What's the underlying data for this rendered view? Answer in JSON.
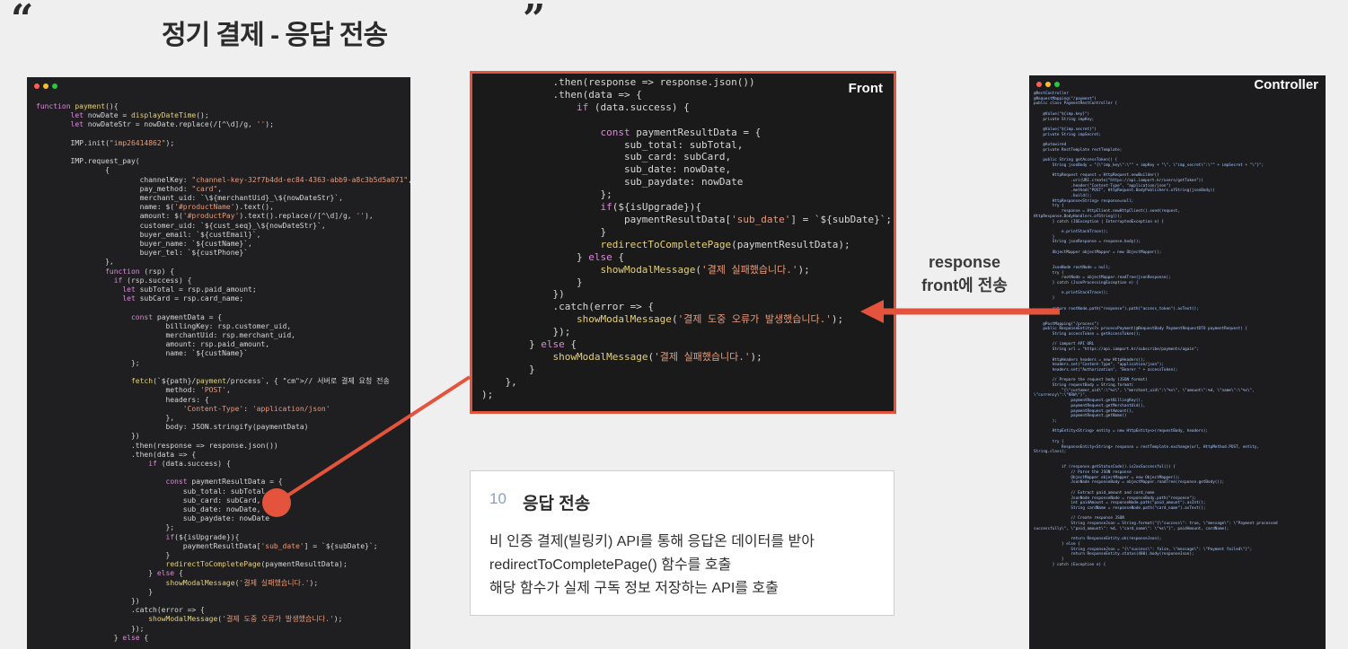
{
  "slide": {
    "open_quote": "“",
    "close_quote": "”",
    "title": "정기 결제 - 응답 전송"
  },
  "left_code": {
    "text": "function payment(){\n\tlet nowDate = displayDateTime();\n\tlet nowDateStr = nowDate.replace(/[^\\d]/g, '');\n\n\tIMP.init(\"imp26414862\");\n\n\tIMP.request_pay(\n\t\t{\n\t\t\tchannelKey: \"channel-key-32f7b4dd-ec84-4363-abb9-a8c3b5d5a071\",\n\t\t\tpay_method: \"card\",\n\t\t\tmerchant_uid: `\\${merchantUid}_\\${nowDateStr}`,\n\t\t\tname: $('#productName').text(),\n\t\t\tamount: $('#productPay').text().replace(/[^\\d]/g, ''),\n\t\t\tcustomer_uid: `${cust_seq}_\\${nowDateStr}`,\n\t\t\tbuyer_email: `${custEmail}`,\n\t\t\tbuyer_name: `${custName}`,\n\t\t\tbuyer_tel: `${custPhone}`\n\t\t},\n\t\tfunction (rsp) {\n\t\t  if (rsp.success) {\n\t\t    let subTotal = rsp.paid_amount;\n\t\t    let subCard = rsp.card_name;\n\n\t\t      const paymentData = {\n\t\t\t      billingKey: rsp.customer_uid,\n\t\t\t      merchantUid: rsp.merchant_uid,\n\t\t\t      amount: rsp.paid_amount,\n\t\t\t      name: `${custName}`\n\t\t      };\n\n\t\t      fetch(`${path}/payment/process`, { // 서버로 결제 요청 전송\n\t\t\t      method: 'POST',\n\t\t\t      headers: {\n\t\t\t\t  'Content-Type': 'application/json'\n\t\t\t      },\n\t\t\t      body: JSON.stringify(paymentData)\n\t\t      })\n\t\t      .then(response => response.json())\n\t\t      .then(data => {\n\t\t\t  if (data.success) {\n\n\t\t\t      const paymentResultData = {\n\t\t\t\t  sub_total: subTotal,\n\t\t\t\t  sub_card: subCard,\n\t\t\t\t  sub_date: nowDate,\n\t\t\t\t  sub_paydate: nowDate\n\t\t\t      };\n\t\t\t      if(${isUpgrade}){\n\t\t\t\t  paymentResultData['sub_date'] = `${subDate}`;\n\t\t\t      }\n\t\t\t      redirectToCompletePage(paymentResultData);\n\t\t\t  } else {\n\t\t\t      showModalMessage('결제 실패했습니다.');\n\t\t\t  }\n\t\t      })\n\t\t      .catch(error => {\n\t\t\t  showModalMessage('결제 도중 오류가 발생했습니다.');\n\t\t      });\n\t\t  } else {"
  },
  "front": {
    "label": "Front",
    "code": "            .then(response => response.json())\n            .then(data => {\n                if (data.success) {\n\n                    const paymentResultData = {\n                        sub_total: subTotal,\n                        sub_card: subCard,\n                        sub_date: nowDate,\n                        sub_paydate: nowDate\n                    };\n                    if(${isUpgrade}){\n                        paymentResultData['sub_date'] = `${subDate}`;\n                    }\n                    redirectToCompletePage(paymentResultData);\n                } else {\n                    showModalMessage('결제 실패했습니다.');\n                }\n            })\n            .catch(error => {\n                showModalMessage('결제 도중 오류가 발생했습니다.');\n            });\n        } else {\n            showModalMessage('결제 실패했습니다.');\n        }\n    },\n);"
  },
  "controller": {
    "label": "Controller",
    "code": "@RestController\n@RequestMapping(\"/payment\")\npublic class PaymentRestController {\n\n    @Value(\"${imp.key}\")\n    private String impKey;\n\n    @Value(\"${imp.secret}\")\n    private String impSecret;\n\n    @Autowired\n    private RestTemplate restTemplate;\n\n    public String getAccessToken() {\n        String jsonBody = \"{\\\"imp_key\\\":\\\"\" + impKey + \"\\\", \\\"imp_secret\\\":\\\"\" + impSecret + \"\\\"}\";\n\n        HttpRequest request = HttpRequest.newBuilder()\n                .uri(URI.create(\"https://api.iamport.kr/users/getToken\"))\n                .header(\"Content-Type\", \"application/json\")\n                .method(\"POST\", HttpRequest.BodyPublishers.ofString(jsonBody))\n                .build();\n        HttpResponse<String> response=null;\n        try {\n            response = HttpClient.newHttpClient().send(request,\nHttpResponse.BodyHandlers.ofString());\n        } catch (IOException | InterruptedException e) {\n\n            e.printStackTrace();\n        }\n        String jsonResponse = response.body();\n\n        ObjectMapper objectMapper = new ObjectMapper();\n\n\n        JsonNode rootNode = null;\n        try {\n            rootNode = objectMapper.readTree(jsonResponse);\n        } catch (JsonProcessingException e) {\n\n            e.printStackTrace();\n        }\n\n        return rootNode.path(\"response\").path(\"access_token\").asText();\n    }\n\n    @PostMapping(\"/process\")\n    public ResponseEntity<?> processPayment(@RequestBody PaymentRequestDTO paymentRequest) {\n        String accessToken = getAccessToken();\n\n        // iamport API URL\n        String url = \"https://api.iamport.kr/subscribe/payments/again\";\n\n        HttpHeaders headers = new HttpHeaders();\n        headers.set(\"Content-Type\", \"application/json\");\n        headers.set(\"Authorization\", \"Bearer \" + accessToken);\n\n        // Prepare the request body (JSON format)\n        String requestBody = String.format(\n            \"{\\\"customer_uid\\\":\\\"%s\\\", \\\"merchant_uid\\\":\\\"%s\\\", \\\"amount\\\":%d, \\\"name\\\":\\\"%s\\\",\n\\\"currency\\\":\\\"KRW\\\"}\",\n                paymentRequest.getBillingKey(),\n                paymentRequest.getMerchantUid(),\n                paymentRequest.getAmount(),\n                paymentRequest.getName()\n        );\n\n        HttpEntity<String> entity = new HttpEntity<>(requestBody, headers);\n\n        try {\n            ResponseEntity<String> response = restTemplate.exchange(url, HttpMethod.POST, entity,\nString.class);\n\n\n            if (response.getStatusCode().is2xxSuccessful()) {\n                // Parse the JSON response\n                ObjectMapper objectMapper = new ObjectMapper();\n                JsonNode responseBody = objectMapper.readTree(response.getBody());\n\n                // Extract paid_amount and card_name\n                JsonNode responseNode = responseBody.path(\"response\");\n                int paidAmount = responseNode.path(\"paid_amount\").asInt();\n                String cardName = responseNode.path(\"card_name\").asText();\n\n                // Create response JSON\n                String responseJson = String.format(\"{\\\"success\\\": true, \\\"message\\\": \\\"Payment processed\nsuccessfully\\\", \\\"paid_amount\\\": %d, \\\"card_name\\\": \\\"%s\\\"}\", paidAmount, cardName);\n\n                return ResponseEntity.ok(responseJson);\n            } else {\n                String responseJson = \"{\\\"success\\\": false, \\\"message\\\": \\\"Payment failed\\\"}\";\n                return ResponseEntity.status(400).body(responseJson);\n            }\n        } catch (Exception e) {"
  },
  "arrow_label": {
    "line1": "response",
    "line2": "front에 전송"
  },
  "info": {
    "number": "10",
    "heading": "응답 전송",
    "line1": "비 인증 결제(빌링키) API를 통해 응답온 데이터를 받아",
    "line2": "redirectToCompletePage() 함수를 호출",
    "line3": "해당 함수가 실제 구독 정보 저장하는 API를 호출"
  },
  "colors": {
    "accent": "#e4543c",
    "background": "#efefef",
    "code_bg": "#1f1f21"
  }
}
